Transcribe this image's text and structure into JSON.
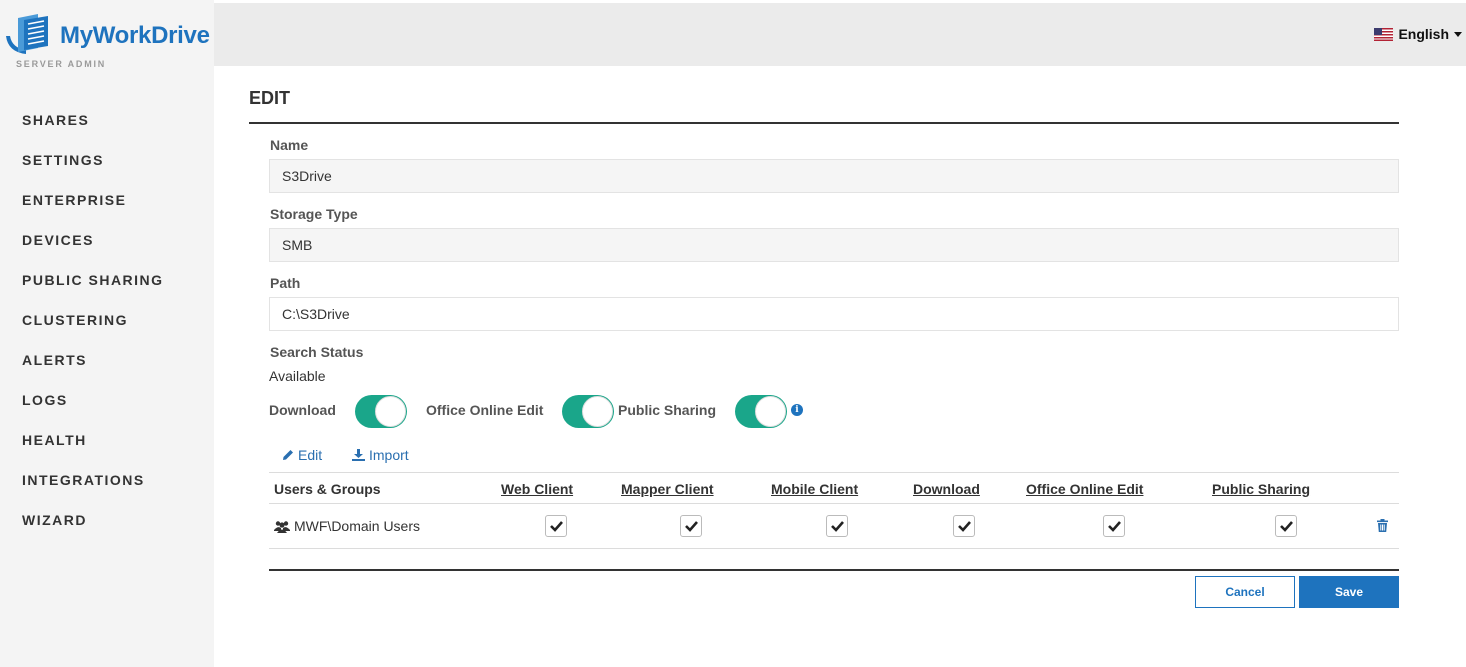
{
  "brand": {
    "name": "MyWorkDrive",
    "subtitle": "SERVER ADMIN",
    "color": "#1e73be"
  },
  "sidebar": {
    "items": [
      {
        "label": "SHARES"
      },
      {
        "label": "SETTINGS"
      },
      {
        "label": "ENTERPRISE"
      },
      {
        "label": "DEVICES"
      },
      {
        "label": "PUBLIC SHARING"
      },
      {
        "label": "CLUSTERING"
      },
      {
        "label": "ALERTS"
      },
      {
        "label": "LOGS"
      },
      {
        "label": "HEALTH"
      },
      {
        "label": "INTEGRATIONS"
      },
      {
        "label": "WIZARD"
      }
    ]
  },
  "header": {
    "language": "English",
    "flag_icon": "us-flag-icon"
  },
  "page": {
    "title": "EDIT"
  },
  "form": {
    "name": {
      "label": "Name",
      "value": "S3Drive"
    },
    "storage_type": {
      "label": "Storage Type",
      "value": "SMB"
    },
    "path": {
      "label": "Path",
      "value": "C:\\S3Drive"
    },
    "search_status": {
      "label": "Search Status",
      "value": "Available"
    },
    "toggles": [
      {
        "label": "Download",
        "on": true
      },
      {
        "label": "Office Online Edit",
        "on": true
      },
      {
        "label": "Public Sharing",
        "on": true
      }
    ],
    "toggle_color": "#1aa68a"
  },
  "actions": {
    "edit": "Edit",
    "import": "Import"
  },
  "table": {
    "headers": [
      "Users & Groups",
      "Web Client",
      "Mapper Client",
      "Mobile Client",
      "Download",
      "Office Online Edit",
      "Public Sharing"
    ],
    "rows": [
      {
        "user": "MWF\\Domain Users",
        "web_client": true,
        "mapper_client": true,
        "mobile_client": true,
        "download": true,
        "office_online_edit": true,
        "public_sharing": true
      }
    ]
  },
  "buttons": {
    "cancel": "Cancel",
    "save": "Save"
  }
}
